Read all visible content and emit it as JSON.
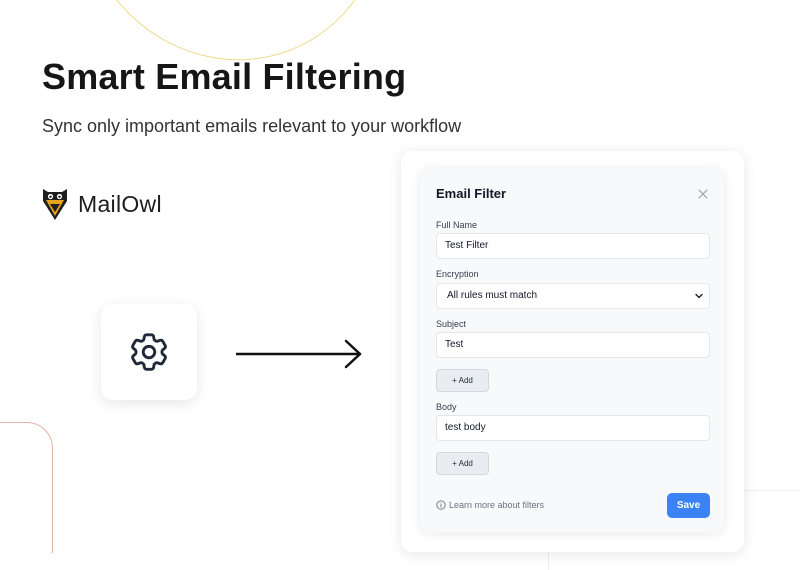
{
  "hero": {
    "title": "Smart Email Filtering",
    "subtitle": "Sync only important emails relevant to your workflow"
  },
  "brand": {
    "name": "MailOwl",
    "logo_icon": "owl-logo-icon"
  },
  "illustration": {
    "gear_icon": "gear-icon",
    "arrow_icon": "arrow-right-icon"
  },
  "dialog": {
    "title": "Email Filter",
    "close_icon": "close-icon",
    "full_name": {
      "label": "Full Name",
      "value": "Test Filter"
    },
    "encryption": {
      "label": "Encryption",
      "selected": "All rules must match"
    },
    "subject": {
      "label": "Subject",
      "value": "Test",
      "add_label": "+ Add"
    },
    "body": {
      "label": "Body",
      "value": "test body",
      "add_label": "+ Add"
    },
    "learn_more": "Learn more about filters",
    "save_label": "Save"
  },
  "colors": {
    "accent": "#3b82f6",
    "logo_gold": "#e6a21c",
    "arc_yellow": "#f2d98a",
    "arc_red": "#e8b3a6"
  }
}
